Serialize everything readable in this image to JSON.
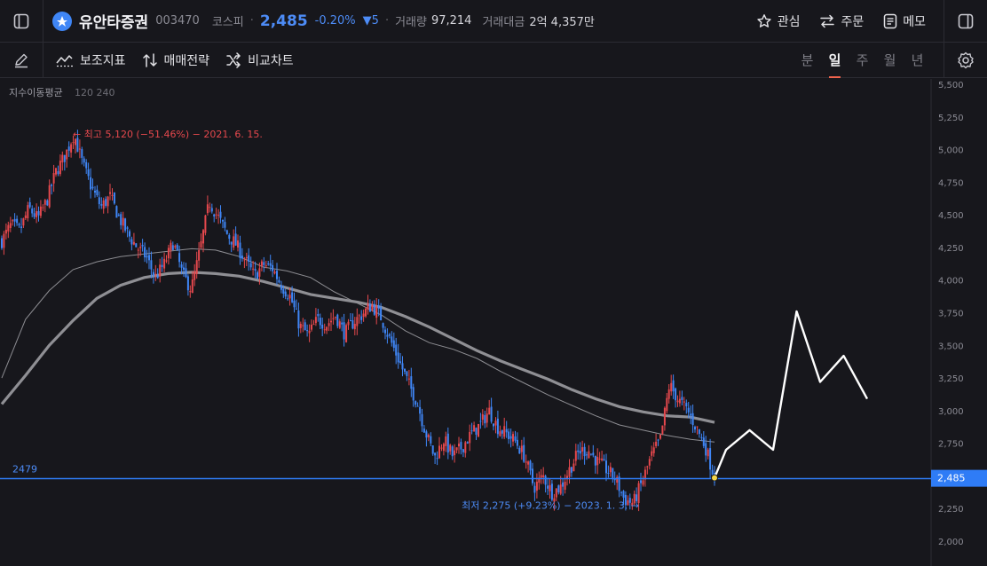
{
  "stock": {
    "name": "유안타증권",
    "code": "003470",
    "market": "코스피",
    "price": "2,485",
    "change_pct": "-0.20%",
    "change_abs": "▼5",
    "volume_label": "거래량",
    "volume": "97,214",
    "amount_label": "거래대금",
    "amount": "2억 4,357만"
  },
  "actions": {
    "watch": "관심",
    "order": "주문",
    "memo": "메모"
  },
  "toolbar": {
    "indicators": "보조지표",
    "strategy": "매매전략",
    "compare": "비교차트"
  },
  "periods": [
    "분",
    "일",
    "주",
    "월",
    "년"
  ],
  "selected_period": "일",
  "colors": {
    "up": "#e5484d",
    "down": "#3f86f6",
    "accent": "#4d8cf7",
    "price_line": "#2f7cf6",
    "highlight": "#f0634d"
  },
  "chart_data": {
    "type": "line",
    "title": "",
    "indicator_label": "지수이동평균",
    "indicator_params": "120 240",
    "ylim": [
      2000,
      5500
    ],
    "y_ticks": [
      "5,500",
      "5,250",
      "5,000",
      "4,750",
      "4,500",
      "4,250",
      "4,000",
      "3,750",
      "3,500",
      "3,250",
      "3,000",
      "2,750",
      "2,500",
      "2,250",
      "2,000"
    ],
    "current_price_label": "2,485",
    "current_price": 2485,
    "line_label": "2479",
    "horizontal_line": 2479,
    "high_annotation": "← 최고 5,120 (−51.46%) − 2021. 6. 15.",
    "low_annotation": "최저 2,275 (+9.23%) − 2023. 1. 3. →",
    "series": [
      {
        "name": "",
        "values": [
          4300,
          4420,
          4380,
          4550,
          4470,
          4610,
          4830,
          4950,
          5120,
          4880,
          4700,
          4560,
          4640,
          4480,
          4350,
          4250,
          4180,
          4020,
          4120,
          4290,
          4050,
          3930,
          4240,
          4600,
          4480,
          4350,
          4270,
          4150,
          4030,
          4120,
          4090,
          3960,
          3870,
          3650,
          3580,
          3700,
          3660,
          3730,
          3590,
          3680,
          3740,
          3810,
          3720,
          3550,
          3390,
          3220,
          3070,
          2830,
          2640,
          2780,
          2650,
          2720,
          2820,
          2890,
          3000,
          2870,
          2820,
          2760,
          2640,
          2410,
          2500,
          2370,
          2420,
          2560,
          2690,
          2700,
          2610,
          2550,
          2480,
          2320,
          2290,
          2460,
          2650,
          2780,
          3200,
          3080,
          3000,
          2870,
          2720,
          2485
        ]
      },
      {
        "name": "",
        "values": [
          3250,
          3700,
          3920,
          4080,
          4140,
          4180,
          4200,
          4220,
          4240,
          4230,
          4180,
          4100,
          4070,
          4020,
          3910,
          3820,
          3730,
          3610,
          3520,
          3470,
          3400,
          3300,
          3210,
          3120,
          3040,
          2960,
          2890,
          2850,
          2810,
          2780,
          2760
        ]
      },
      {
        "name": "",
        "values": [
          3050,
          3270,
          3500,
          3690,
          3860,
          3960,
          4020,
          4050,
          4060,
          4050,
          4030,
          3990,
          3940,
          3890,
          3860,
          3830,
          3790,
          3720,
          3640,
          3550,
          3460,
          3380,
          3310,
          3240,
          3160,
          3090,
          3030,
          2990,
          2960,
          2950,
          2910
        ]
      },
      {
        "name": "",
        "values": [
          2700,
          2850,
          2700,
          3760,
          3220,
          3420,
          3090
        ]
      }
    ]
  }
}
